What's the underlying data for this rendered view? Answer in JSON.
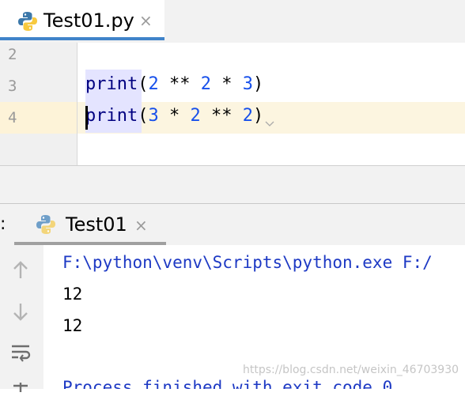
{
  "editor_tab": {
    "title": "Test01.py",
    "close": "×",
    "icon": "python-file-icon"
  },
  "editor": {
    "line_numbers": [
      "2",
      "3",
      "4"
    ],
    "lines": [
      {
        "fn": "print",
        "open": "(",
        "a": "2",
        "op1": " ** ",
        "b": "2",
        "op2": " * ",
        "c": "3",
        "close": ")"
      },
      {
        "fn": "print",
        "open": "(",
        "a": "3",
        "op1": " * ",
        "b": "2",
        "op2": " ** ",
        "c": "2",
        "close": ")"
      }
    ]
  },
  "run_tab": {
    "prefix": ":",
    "title": "Test01",
    "close": "×",
    "icon": "python-file-icon"
  },
  "console": {
    "command": "F:\\python\\venv\\Scripts\\python.exe F:/",
    "output": [
      "12",
      "12"
    ],
    "exit_message": "Process finished with exit code 0"
  },
  "toolbar_icons": [
    "arrow-up-icon",
    "arrow-down-icon",
    "soft-wrap-icon",
    "scroll-to-end-icon"
  ],
  "watermark": "https://blog.csdn.net/weixin_46703930",
  "colors": {
    "accent": "#4083c9",
    "keyword": "#000080",
    "number": "#1750eb",
    "console_link": "#1d39c4",
    "current_line": "#fcf5e0"
  }
}
